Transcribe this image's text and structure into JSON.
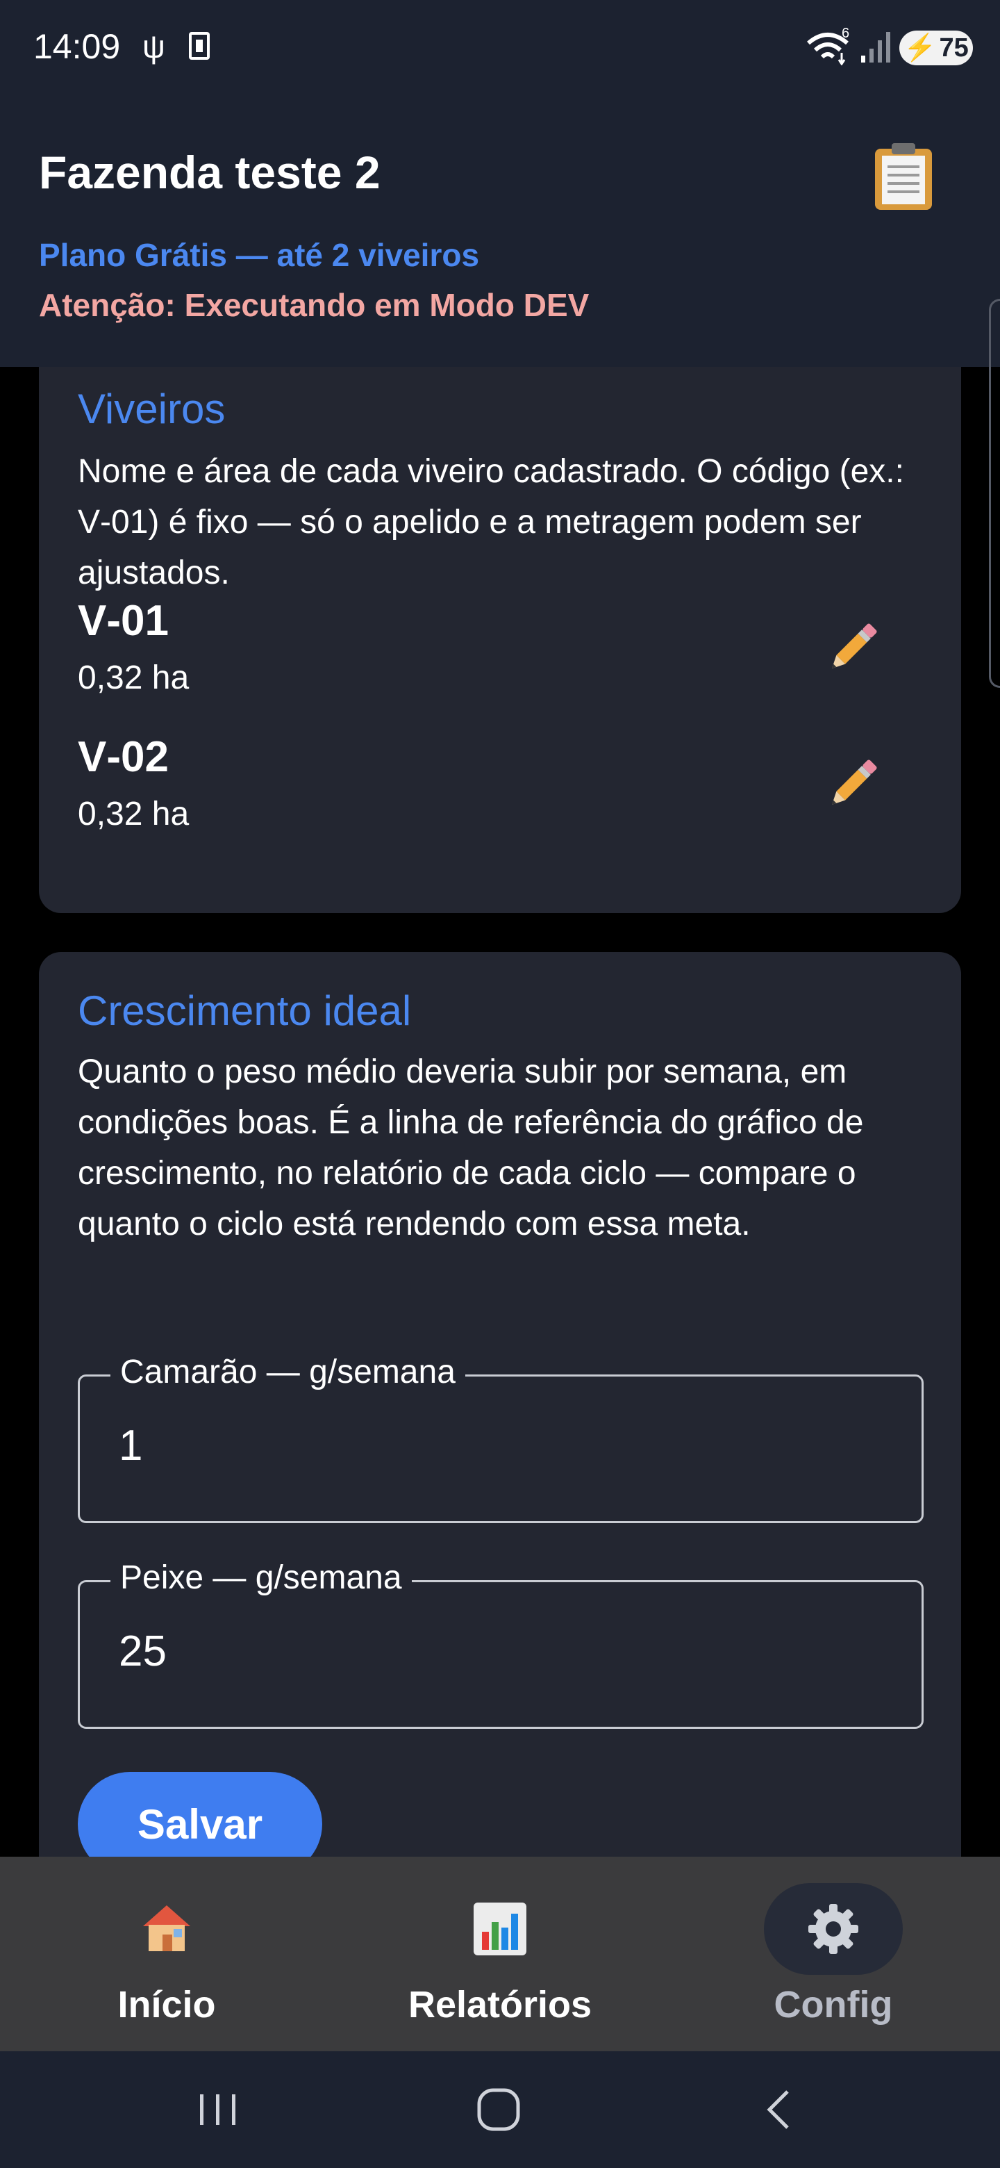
{
  "status_bar": {
    "time": "14:09",
    "usb_icon": "usb-icon",
    "sim_icon": "sim-card-icon",
    "wifi_icon": "wifi-6-icon",
    "wifi_badge": "6",
    "signal_icon": "signal-icon",
    "battery_level": "75",
    "battery_icon": "battery-charging-icon"
  },
  "header": {
    "title": "Fazenda teste 2",
    "plan": "Plano Grátis — até 2 viveiros",
    "dev_warning": "Atenção: Executando em Modo DEV",
    "clipboard_icon": "clipboard-icon"
  },
  "viveiros": {
    "title": "Viveiros",
    "description": "Nome e área de cada viveiro cadastrado. O código (ex.: V‑01) é fixo — só o apelido e a metragem podem ser ajustados.",
    "items": [
      {
        "code": "V‑01",
        "area": "0,32 ha"
      },
      {
        "code": "V‑02",
        "area": "0,32 ha"
      }
    ],
    "edit_icon": "pencil-icon"
  },
  "crescimento": {
    "title": "Crescimento ideal",
    "description": "Quanto o peso médio deveria subir por semana, em condições boas. É a linha de referência do gráfico de crescimento, no relatório de cada ciclo — compare o quanto o ciclo está rendendo com essa meta.",
    "fields": [
      {
        "label": "Camarão — g/semana",
        "value": "1"
      },
      {
        "label": "Peixe — g/semana",
        "value": "25"
      }
    ],
    "save_label": "Salvar"
  },
  "bottom_nav": {
    "items": [
      {
        "label": "Início",
        "icon": "house-icon"
      },
      {
        "label": "Relatórios",
        "icon": "bar-chart-icon"
      },
      {
        "label": "Config",
        "icon": "gear-icon",
        "active": true
      }
    ]
  },
  "system_nav": {
    "recents_icon": "recents-icon",
    "home_icon": "home-circle-icon",
    "back_icon": "back-icon"
  },
  "colors": {
    "accent": "#4b88f0",
    "warning": "#f3a7a3",
    "card_bg": "#232631",
    "header_bg": "#1c2230",
    "button": "#3f7df0"
  }
}
